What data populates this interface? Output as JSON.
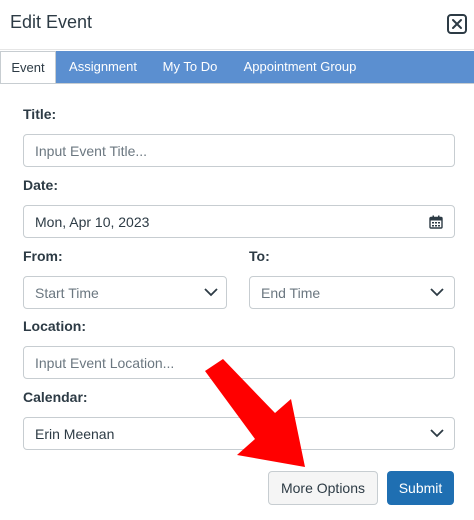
{
  "dialog": {
    "title": "Edit Event"
  },
  "tabs": [
    {
      "label": "Event",
      "active": true
    },
    {
      "label": "Assignment"
    },
    {
      "label": "My To Do"
    },
    {
      "label": "Appointment Group"
    }
  ],
  "form": {
    "title": {
      "label": "Title:",
      "placeholder": "Input Event Title..."
    },
    "date": {
      "label": "Date:",
      "value": "Mon, Apr 10, 2023"
    },
    "from": {
      "label": "From:",
      "placeholder": "Start Time"
    },
    "to": {
      "label": "To:",
      "placeholder": "End Time"
    },
    "location": {
      "label": "Location:",
      "placeholder": "Input Event Location..."
    },
    "calendar": {
      "label": "Calendar:",
      "value": "Erin Meenan"
    }
  },
  "actions": {
    "more_options": "More Options",
    "submit": "Submit"
  },
  "colors": {
    "tab_bar": "#5b8fd0",
    "submit": "#1f6fb2",
    "annotation_arrow": "#ff0000"
  }
}
